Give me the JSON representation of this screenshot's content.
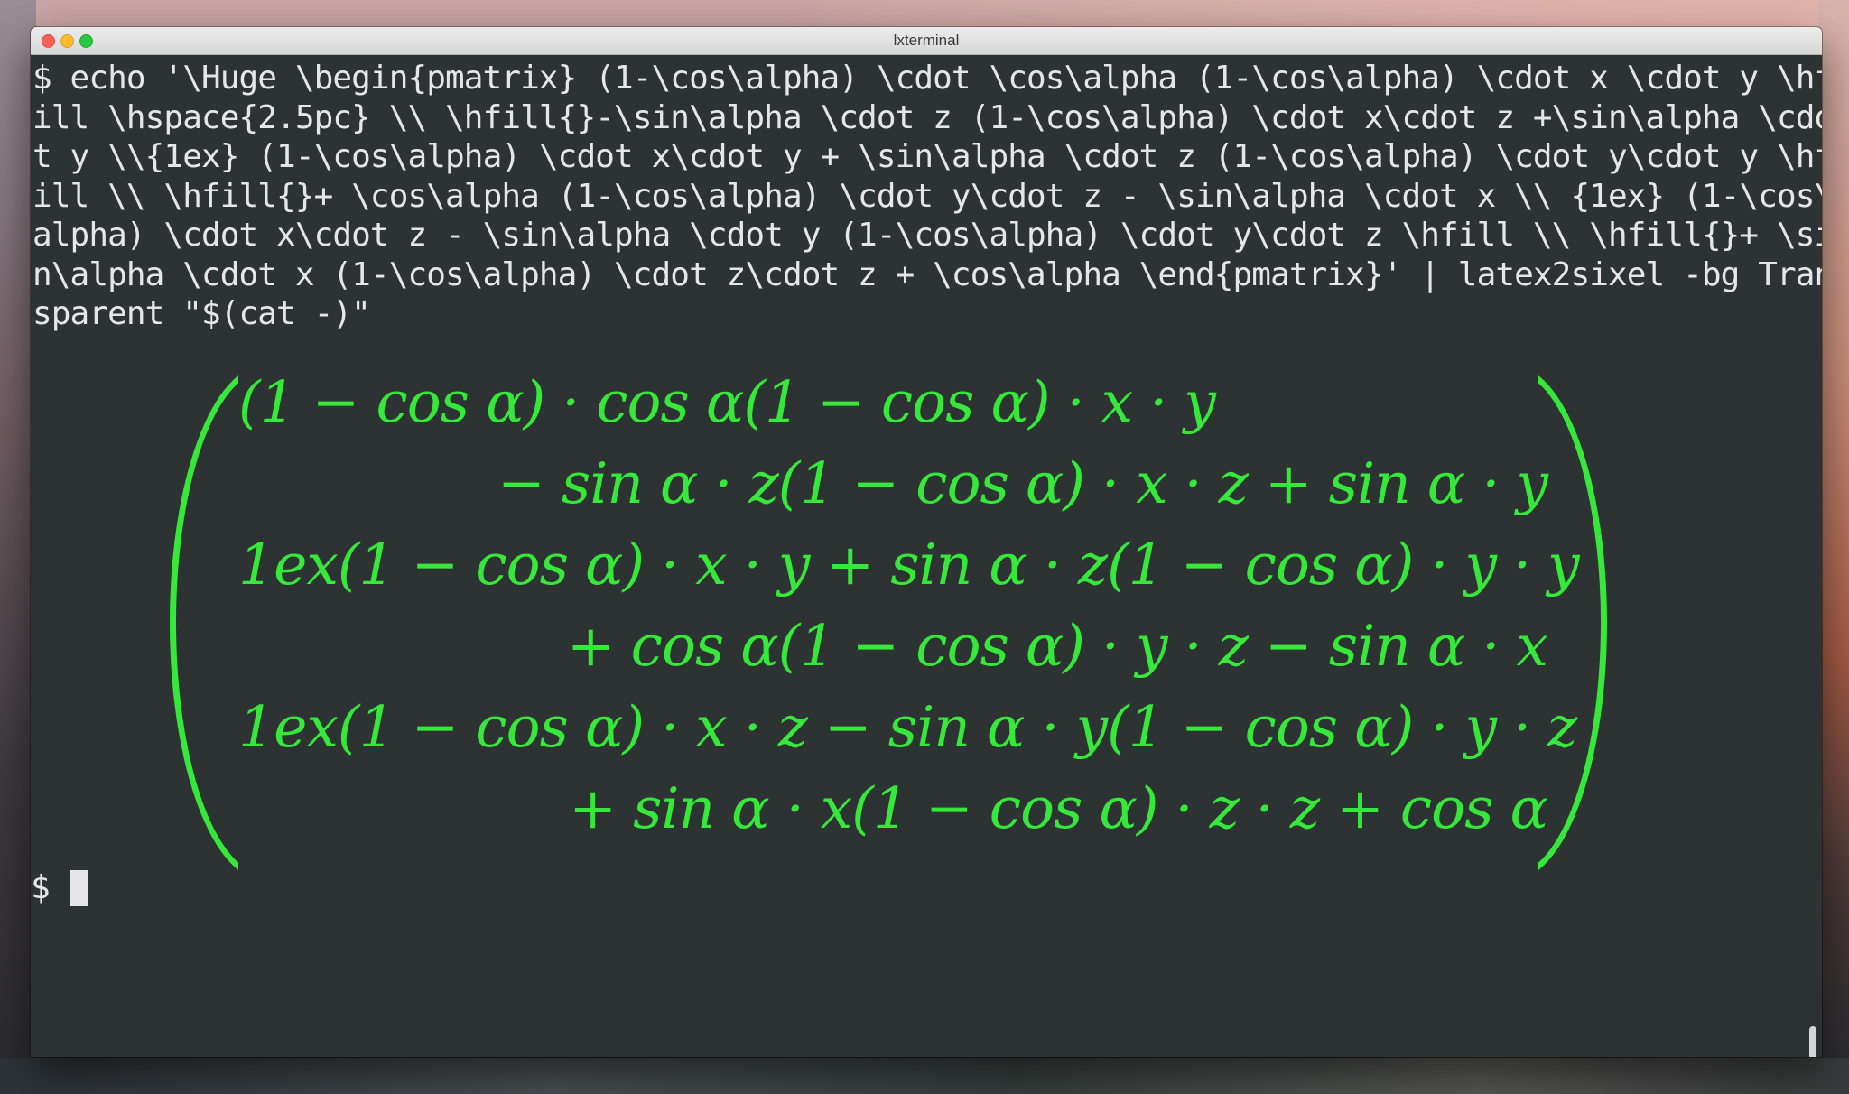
{
  "window": {
    "title": "lxterminal"
  },
  "terminal": {
    "command_lines": [
      "$ echo '\\Huge \\begin{pmatrix} (1-\\cos\\alpha) \\cdot \\cos\\alpha (1-\\cos\\alpha) \\cdot x \\cdot y \\hf",
      "ill \\hspace{2.5pc} \\\\ \\hfill{}-\\sin\\alpha \\cdot z (1-\\cos\\alpha) \\cdot x\\cdot z +\\sin\\alpha \\cdo",
      "t y \\\\{1ex} (1-\\cos\\alpha) \\cdot x\\cdot y + \\sin\\alpha \\cdot z (1-\\cos\\alpha) \\cdot y\\cdot y \\hf",
      "ill \\\\ \\hfill{}+ \\cos\\alpha (1-\\cos\\alpha) \\cdot y\\cdot z - \\sin\\alpha \\cdot x \\\\ {1ex} (1-\\cos\\",
      "alpha) \\cdot x\\cdot z - \\sin\\alpha \\cdot y (1-\\cos\\alpha) \\cdot y\\cdot z \\hfill \\\\ \\hfill{}+ \\si",
      "n\\alpha \\cdot x (1-\\cos\\alpha) \\cdot z\\cdot z + \\cos\\alpha \\end{pmatrix}' | latex2sixel -bg Tran",
      "sparent \"$(cat -)\""
    ],
    "math_rows": [
      "(1 − cos α) · cos α(1 − cos α) · x · y",
      "− sin α · z(1 − cos α) · x · z + sin α · y",
      "1ex(1 − cos α) · x · y + sin α · z(1 − cos α) · y · y",
      "+ cos α(1 − cos α) · y · z − sin α · x",
      "1ex(1 − cos α) · x · z − sin α · y(1 − cos α) · y · z",
      "+ sin α · x(1 − cos α) · z · z + cos α"
    ],
    "prompt": "$",
    "math_color": "#35e83a",
    "background_color": "#2d3233"
  }
}
